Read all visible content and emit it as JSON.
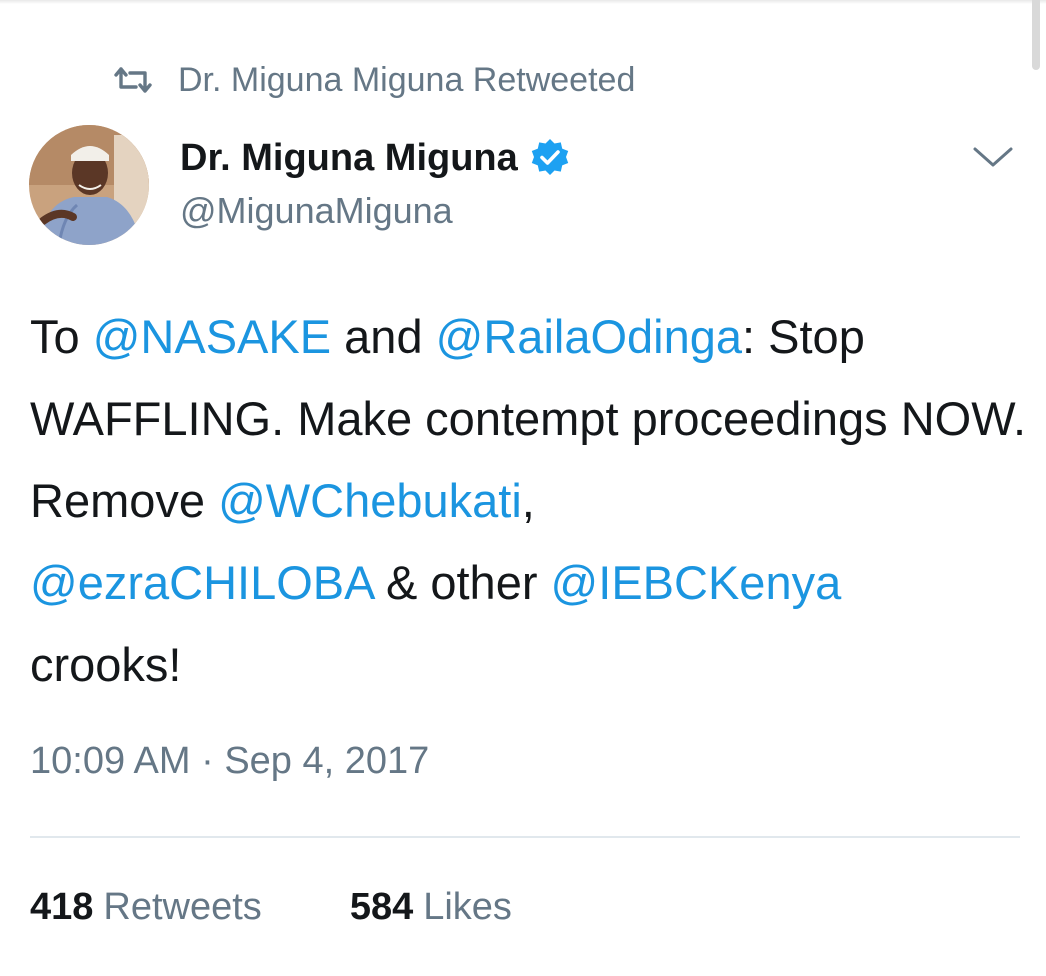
{
  "retweet_context": {
    "text": "Dr. Miguna Miguna Retweeted",
    "icon": "retweet-icon"
  },
  "author": {
    "name": "Dr. Miguna Miguna",
    "handle": "@MigunaMiguna",
    "verified": true
  },
  "tweet": {
    "segments": [
      {
        "text": "To ",
        "type": "text"
      },
      {
        "text": "@NASAKE",
        "type": "mention"
      },
      {
        "text": " and ",
        "type": "text"
      },
      {
        "text": "@RailaOdinga",
        "type": "mention"
      },
      {
        "text": ": Stop WAFFLING. Make contempt proceedings NOW. Remove ",
        "type": "text"
      },
      {
        "text": "@WChebukati",
        "type": "mention"
      },
      {
        "text": ", ",
        "type": "text"
      },
      {
        "text": "@ezraCHILOBA",
        "type": "mention"
      },
      {
        "text": " & other ",
        "type": "text"
      },
      {
        "text": "@IEBCKenya",
        "type": "mention"
      },
      {
        "text": " crooks!",
        "type": "text"
      }
    ],
    "timestamp": "10:09 AM · Sep 4, 2017"
  },
  "stats": {
    "retweets_count": "418",
    "retweets_label": "Retweets",
    "likes_count": "584",
    "likes_label": "Likes"
  },
  "colors": {
    "link": "#1b95e0",
    "secondary_text": "#657786",
    "primary_text": "#14171a",
    "verified_badge": "#1da1f2",
    "divider": "#e1e8ed"
  }
}
